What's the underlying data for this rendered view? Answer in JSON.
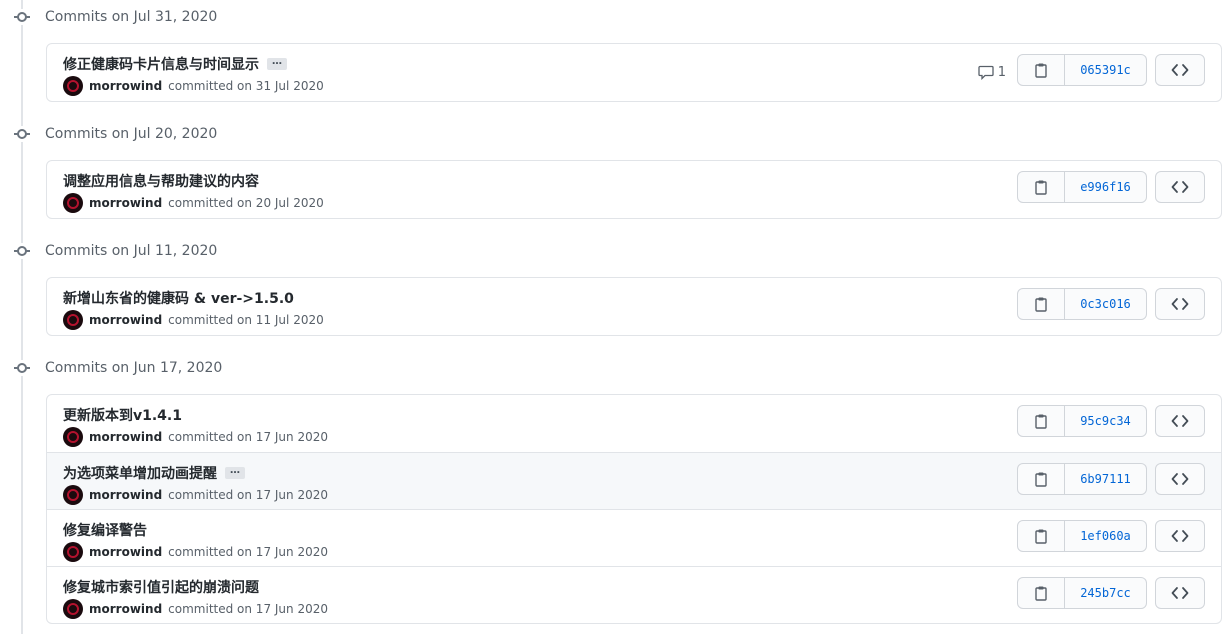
{
  "groups": [
    {
      "title": "Commits on Jul 31, 2020",
      "commits": [
        {
          "message": "修正健康码卡片信息与时间显示",
          "has_ellipsis": true,
          "author": "morrowind",
          "committed": "committed on 31 Jul 2020",
          "sha": "065391c",
          "comments": "1"
        }
      ]
    },
    {
      "title": "Commits on Jul 20, 2020",
      "commits": [
        {
          "message": "调整应用信息与帮助建议的内容",
          "has_ellipsis": false,
          "author": "morrowind",
          "committed": "committed on 20 Jul 2020",
          "sha": "e996f16"
        }
      ]
    },
    {
      "title": "Commits on Jul 11, 2020",
      "commits": [
        {
          "message": "新增山东省的健康码 & ver->1.5.0",
          "has_ellipsis": false,
          "author": "morrowind",
          "committed": "committed on 11 Jul 2020",
          "sha": "0c3c016"
        }
      ]
    },
    {
      "title": "Commits on Jun 17, 2020",
      "commits": [
        {
          "message": "更新版本到v1.4.1",
          "has_ellipsis": false,
          "author": "morrowind",
          "committed": "committed on 17 Jun 2020",
          "sha": "95c9c34"
        },
        {
          "message": "为选项菜单增加动画提醒",
          "has_ellipsis": true,
          "author": "morrowind",
          "committed": "committed on 17 Jun 2020",
          "sha": "6b97111",
          "highlighted": true
        },
        {
          "message": "修复编译警告",
          "has_ellipsis": false,
          "author": "morrowind",
          "committed": "committed on 17 Jun 2020",
          "sha": "1ef060a"
        },
        {
          "message": "修复城市索引值引起的崩溃问题",
          "has_ellipsis": false,
          "author": "morrowind",
          "committed": "committed on 17 Jun 2020",
          "sha": "245b7cc"
        }
      ]
    }
  ],
  "labels": {
    "ellipsis": "…"
  },
  "icons": {
    "timeline": "git-commit-icon",
    "comment": "comment-icon",
    "copy": "clipboard-icon",
    "browse": "code-icon"
  },
  "colors": {
    "sha_link": "#0366d6",
    "border": "#e1e4e8",
    "muted": "#586069"
  }
}
